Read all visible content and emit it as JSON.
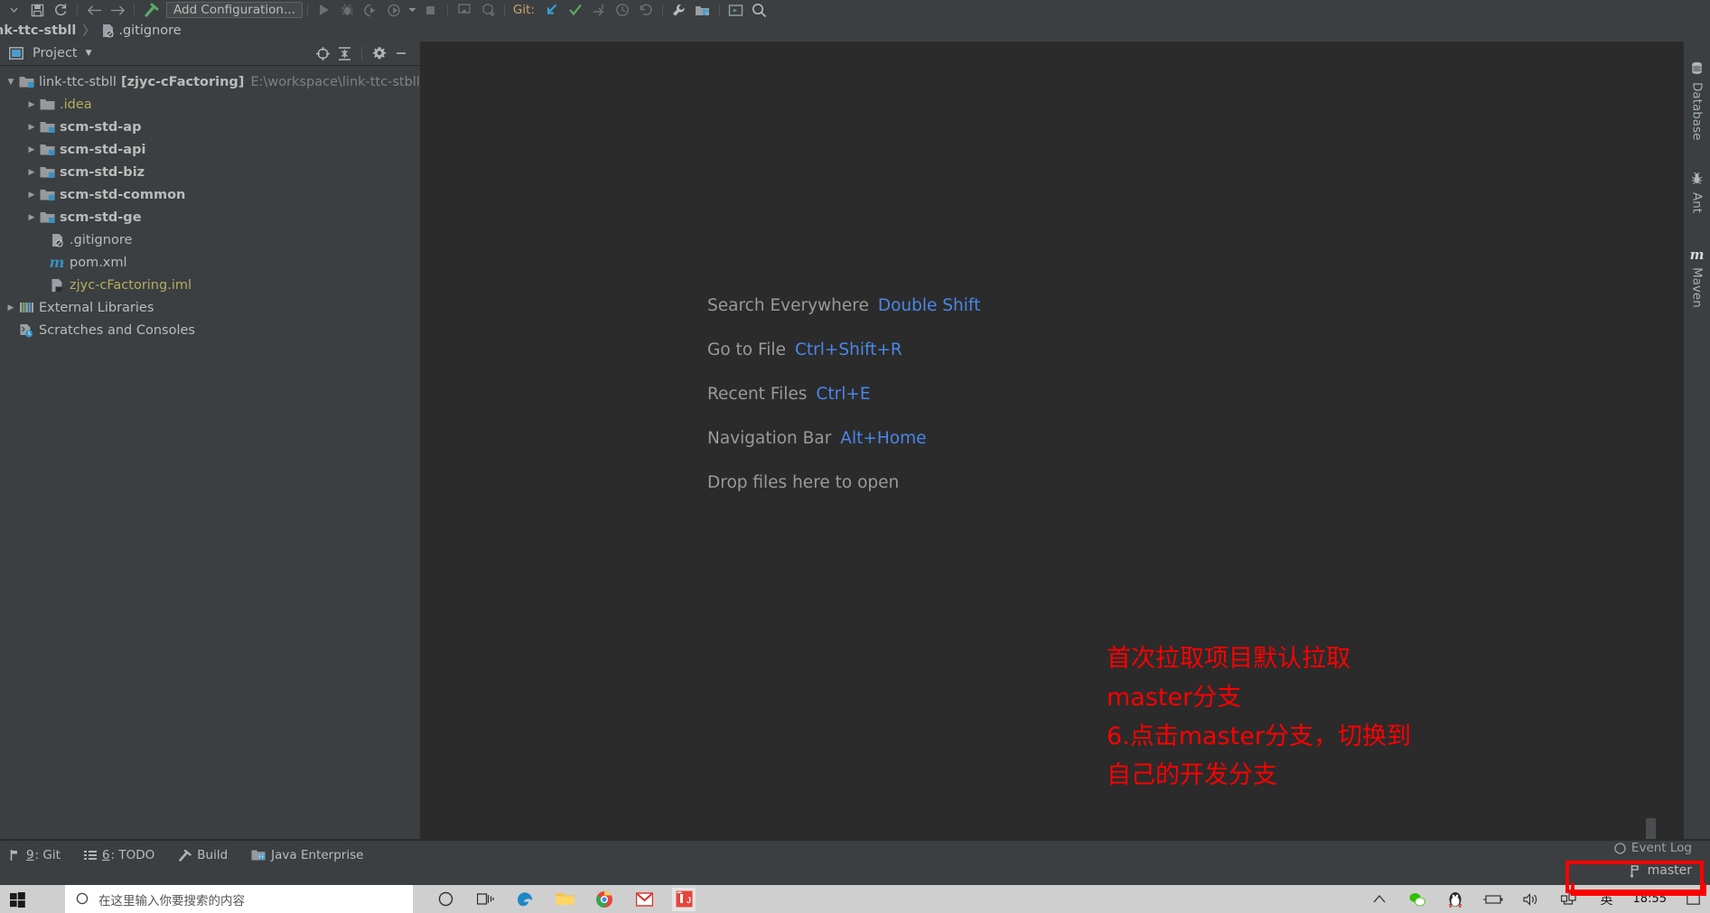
{
  "toolbar": {
    "icons": [
      "save-icon",
      "sync-icon",
      "back-arrow-icon",
      "forward-arrow-icon",
      "build-hammer-icon"
    ],
    "run_configuration": "Add Configuration...",
    "run_icons": [
      "run-icon",
      "debug-icon",
      "run-coverage-icon",
      "profiler-icon",
      "dropdown-caret-icon",
      "stop-icon"
    ],
    "deploy_icons": [
      "update-project-icon",
      "commit-icon"
    ],
    "git_label": "Git:",
    "git_icons": [
      "update-project-blue-arrow-icon",
      "commit-checkmark-icon",
      "push-icon",
      "history-clock-icon",
      "rollback-icon"
    ],
    "right_icons": [
      "settings-wrench-icon",
      "project-structure-icon",
      "terminal-icon",
      "search-icon"
    ]
  },
  "breadcrumb": {
    "project": "nk-ttc-stbll",
    "separator": "〉",
    "file": ".gitignore",
    "file_icon": "gitignore-file-icon"
  },
  "project_panel": {
    "title": "Project",
    "caret": "▼",
    "tools": [
      "locate-target-icon",
      "collapse-all-icon",
      "gear-icon",
      "minimize-icon"
    ],
    "tree": [
      {
        "label": "link-ttc-stbll",
        "module": "[zjyc-cFactoring]",
        "path": "E:\\workspace\\link-ttc-stbll",
        "depth": 0,
        "arrow": "▼",
        "icon": "module-folder-icon",
        "bold": false
      },
      {
        "label": ".idea",
        "depth": 1,
        "arrow": "▶",
        "icon": "folder-icon",
        "bold": false,
        "color": "yellow"
      },
      {
        "label": "scm-std-ap",
        "depth": 1,
        "arrow": "▶",
        "icon": "module-folder-icon",
        "bold": true
      },
      {
        "label": "scm-std-api",
        "depth": 1,
        "arrow": "▶",
        "icon": "module-folder-icon",
        "bold": true
      },
      {
        "label": "scm-std-biz",
        "depth": 1,
        "arrow": "▶",
        "icon": "module-folder-icon",
        "bold": true
      },
      {
        "label": "scm-std-common",
        "depth": 1,
        "arrow": "▶",
        "icon": "module-folder-icon",
        "bold": true
      },
      {
        "label": "scm-std-ge",
        "depth": 1,
        "arrow": "▶",
        "icon": "module-folder-icon",
        "bold": true
      },
      {
        "label": ".gitignore",
        "depth": 2,
        "arrow": "",
        "icon": "gitignore-file-icon",
        "bold": false
      },
      {
        "label": "pom.xml",
        "depth": 2,
        "arrow": "",
        "icon": "maven-m-icon",
        "bold": false
      },
      {
        "label": "zjyc-cFactoring.iml",
        "depth": 2,
        "arrow": "",
        "icon": "iml-file-icon",
        "bold": false,
        "color": "yellow"
      },
      {
        "label": "External Libraries",
        "depth": 0,
        "arrow": "▶",
        "icon": "libraries-icon",
        "bold": false
      },
      {
        "label": "Scratches and Consoles",
        "depth": 0,
        "arrow": "",
        "icon": "scratches-icon",
        "bold": false
      }
    ]
  },
  "editor": {
    "shortcuts": [
      {
        "name": "Search Everywhere",
        "key": "Double Shift"
      },
      {
        "name": "Go to File",
        "key": "Ctrl+Shift+R"
      },
      {
        "name": "Recent Files",
        "key": "Ctrl+E"
      },
      {
        "name": "Navigation Bar",
        "key": "Alt+Home"
      },
      {
        "name": "Drop files here to open",
        "key": ""
      }
    ],
    "annotation": "首次拉取项目默认拉取\nmaster分支\n6.点击master分支，切换到\n自己的开发分支",
    "annotation_color": "#ff0000"
  },
  "right_sidebar": {
    "tabs": [
      {
        "label": "Database",
        "icon": "database-icon"
      },
      {
        "label": "Ant",
        "icon": "ant-bug-icon"
      },
      {
        "label": "Maven",
        "icon": "maven-m-icon"
      }
    ]
  },
  "status_bar": {
    "tools": [
      {
        "num": "9",
        "label": ": Git",
        "icon": "git-branch-icon"
      },
      {
        "num": "6",
        "label": ": TODO",
        "icon": "todo-list-icon"
      },
      {
        "num": "",
        "label": "Build",
        "icon": "build-hammer-icon"
      },
      {
        "num": "",
        "label": "Java Enterprise",
        "icon": "java-enterprise-icon"
      }
    ],
    "event_log": "Event Log",
    "event_log_icon": "event-log-icon",
    "branch": "master",
    "branch_icon": "git-branch-icon",
    "highlight_color": "#ff0000"
  },
  "taskbar": {
    "start_icon": "windows-start-icon",
    "search_placeholder": "在这里输入你要搜索的内容",
    "search_icon": "search-circle-icon",
    "pinned": [
      "cortana-circle-icon",
      "task-view-icon",
      "edge-icon",
      "file-explorer-icon",
      "chrome-icon",
      "gmail-icon",
      "intellij-idea-icon"
    ],
    "tray": [
      "show-hidden-icon",
      "wechat-icon",
      "qq-penguin-icon",
      "battery-icon",
      "volume-icon",
      "network-icon",
      "ime-chinese-icon"
    ],
    "time": "18:55"
  }
}
